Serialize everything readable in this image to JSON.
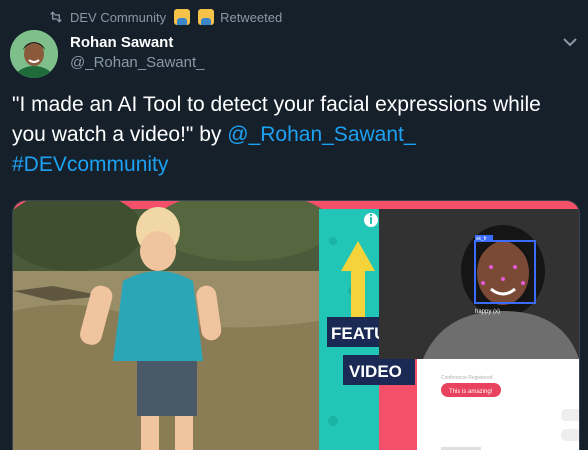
{
  "retweet": {
    "community": "DEV Community",
    "action": "Retweeted"
  },
  "author": {
    "name": "Rohan Sawant",
    "handle": "@_Rohan_Sawant_"
  },
  "tweet": {
    "text_before": "\"I made an AI Tool to detect your facial expressions while you watch a video!\" by ",
    "mention": "@_Rohan_Sawant_",
    "hashtag": "#DEVcommunity"
  },
  "media": {
    "featured_label": "FEATU",
    "video_label": "VIDEO",
    "face_label": "happy (x)",
    "box_label": "sk_fr",
    "chat_header": "Conference Registered",
    "chat_bubble": "This is amazing!"
  },
  "colors": {
    "background": "#15202b",
    "link": "#1da1f2",
    "muted": "#8899a6",
    "teal": "#22c6b6",
    "accent_pink": "#e8425e"
  }
}
